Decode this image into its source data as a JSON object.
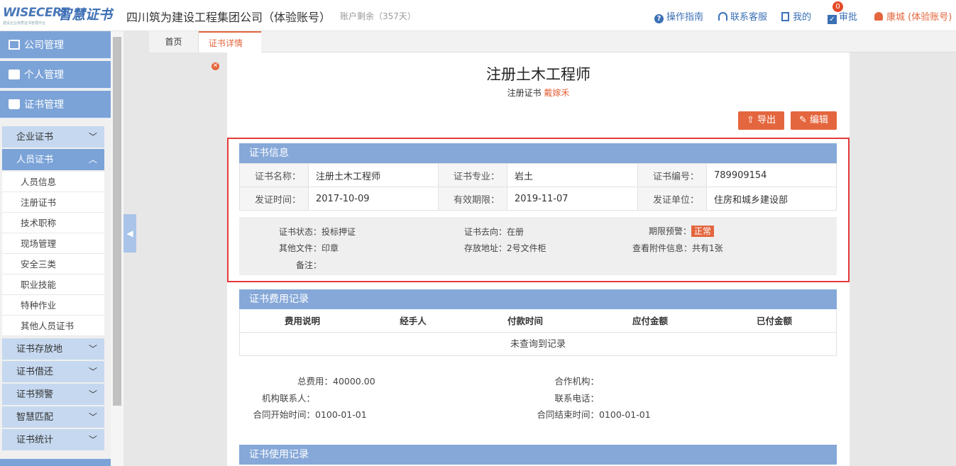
{
  "header": {
    "logo_en": "WISECERT",
    "logo_cn": "智慧证书",
    "logo_sub": "建设企业资质证书管理平台",
    "company": "四川筑为建设工程集团公司（体验账号）",
    "remain": "账户剩余（357天）",
    "nav": {
      "guide": "操作指南",
      "service": "联系客服",
      "mine": "我的",
      "approve": "审批",
      "approve_badge": "0",
      "user": "康城 (体验账号)"
    }
  },
  "sidebar": {
    "top": [
      "公司管理",
      "个人管理",
      "证书管理"
    ],
    "sub_before": [
      "企业证书",
      "人员证书"
    ],
    "items": [
      "人员信息",
      "注册证书",
      "技术职称",
      "现场管理",
      "安全三类",
      "职业技能",
      "特种作业",
      "其他人员证书"
    ],
    "sub_after": [
      "证书存放地",
      "证书借还",
      "证书预警",
      "智慧匹配",
      "证书统计"
    ]
  },
  "tabs": {
    "home": "首页",
    "current": "证书详情"
  },
  "page": {
    "title": "注册土木工程师",
    "subtitle": "注册证书",
    "person": "戴嫁禾",
    "export_label": "导出",
    "edit_label": "编辑"
  },
  "cert_info": {
    "section_title": "证书信息",
    "rows": [
      [
        [
          "证书名称：",
          "注册土木工程师"
        ],
        [
          "证书专业：",
          "岩土"
        ],
        [
          "证书编号：",
          "789909154"
        ]
      ],
      [
        [
          "发证时间：",
          "2017-10-09"
        ],
        [
          "有效期限：",
          "2019-11-07"
        ],
        [
          "发证单位：",
          "住房和城乡建设部"
        ]
      ]
    ],
    "extra": {
      "status": "证书状态：投标押证",
      "direction": "证书去向：在册",
      "warning_label": "期限预警：",
      "warning_tag": "正常",
      "other_files": "其他文件：印章",
      "location": "存放地址：2号文件柜",
      "attachments": "查看附件信息：共有1张",
      "remark": "备注："
    }
  },
  "fee": {
    "section_title": "证书费用记录",
    "columns": [
      "费用说明",
      "经手人",
      "付款时间",
      "应付金额",
      "已付金额"
    ],
    "empty": "未查询到记录",
    "total_label": "总费用：",
    "total_value": "40000.00",
    "org_label": "合作机构：",
    "contact_label": "机构联系人：",
    "phone_label": "联系电话：",
    "start_label": "合同开始时间：",
    "start_value": "0100-01-01",
    "end_label": "合同结束时间：",
    "end_value": "0100-01-01"
  },
  "usage": {
    "section_title": "证书使用记录"
  },
  "colors": {
    "accent": "#e4663e",
    "primary_blue": "#7ba3d8",
    "section_blue": "#86a8d8",
    "highlight_red": "#e53a3a"
  }
}
